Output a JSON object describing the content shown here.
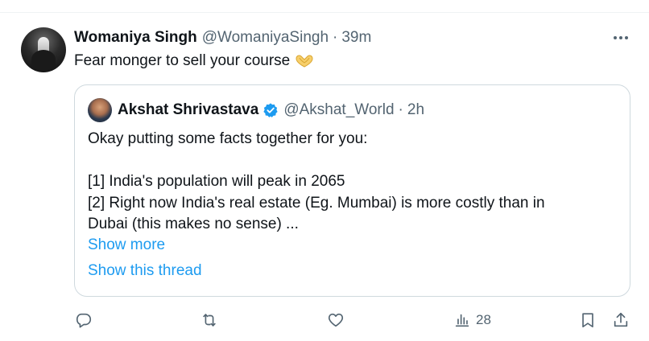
{
  "tweet": {
    "author_name": "Womaniya Singh",
    "author_handle": "@WomaniyaSingh",
    "separator": "·",
    "time": "39m",
    "text": "Fear monger to sell your course",
    "emoji_icon": "heart-hands-icon"
  },
  "quoted_tweet": {
    "author_name": "Akshat Shrivastava",
    "author_handle": "@Akshat_World",
    "separator": "·",
    "time": "2h",
    "verified_icon": "verified-badge-icon",
    "lines": [
      "Okay putting some facts together for you:",
      "",
      "[1] India's population will peak in 2065",
      "[2] Right now India's real estate (Eg. Mumbai) is more costly than in",
      "Dubai (this makes no sense)  ..."
    ],
    "show_more": "Show more",
    "show_thread": "Show this thread"
  },
  "actions": {
    "reply_icon": "reply-icon",
    "retweet_icon": "retweet-icon",
    "like_icon": "like-icon",
    "views_icon": "views-icon",
    "views_count": "28",
    "bookmark_icon": "bookmark-icon",
    "share_icon": "share-icon"
  },
  "colors": {
    "accent": "#1d9bf0",
    "secondary_text": "#536471",
    "border": "#cfd9de"
  }
}
